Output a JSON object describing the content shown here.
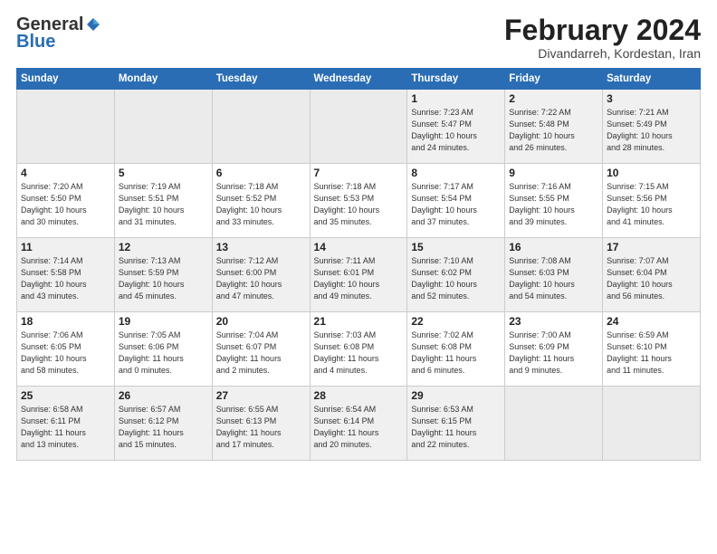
{
  "logo": {
    "line1": "General",
    "line2": "Blue"
  },
  "title": {
    "month": "February 2024",
    "location": "Divandarreh, Kordestan, Iran"
  },
  "weekdays": [
    "Sunday",
    "Monday",
    "Tuesday",
    "Wednesday",
    "Thursday",
    "Friday",
    "Saturday"
  ],
  "weeks": [
    [
      {
        "day": "",
        "detail": ""
      },
      {
        "day": "",
        "detail": ""
      },
      {
        "day": "",
        "detail": ""
      },
      {
        "day": "",
        "detail": ""
      },
      {
        "day": "1",
        "detail": "Sunrise: 7:23 AM\nSunset: 5:47 PM\nDaylight: 10 hours\nand 24 minutes."
      },
      {
        "day": "2",
        "detail": "Sunrise: 7:22 AM\nSunset: 5:48 PM\nDaylight: 10 hours\nand 26 minutes."
      },
      {
        "day": "3",
        "detail": "Sunrise: 7:21 AM\nSunset: 5:49 PM\nDaylight: 10 hours\nand 28 minutes."
      }
    ],
    [
      {
        "day": "4",
        "detail": "Sunrise: 7:20 AM\nSunset: 5:50 PM\nDaylight: 10 hours\nand 30 minutes."
      },
      {
        "day": "5",
        "detail": "Sunrise: 7:19 AM\nSunset: 5:51 PM\nDaylight: 10 hours\nand 31 minutes."
      },
      {
        "day": "6",
        "detail": "Sunrise: 7:18 AM\nSunset: 5:52 PM\nDaylight: 10 hours\nand 33 minutes."
      },
      {
        "day": "7",
        "detail": "Sunrise: 7:18 AM\nSunset: 5:53 PM\nDaylight: 10 hours\nand 35 minutes."
      },
      {
        "day": "8",
        "detail": "Sunrise: 7:17 AM\nSunset: 5:54 PM\nDaylight: 10 hours\nand 37 minutes."
      },
      {
        "day": "9",
        "detail": "Sunrise: 7:16 AM\nSunset: 5:55 PM\nDaylight: 10 hours\nand 39 minutes."
      },
      {
        "day": "10",
        "detail": "Sunrise: 7:15 AM\nSunset: 5:56 PM\nDaylight: 10 hours\nand 41 minutes."
      }
    ],
    [
      {
        "day": "11",
        "detail": "Sunrise: 7:14 AM\nSunset: 5:58 PM\nDaylight: 10 hours\nand 43 minutes."
      },
      {
        "day": "12",
        "detail": "Sunrise: 7:13 AM\nSunset: 5:59 PM\nDaylight: 10 hours\nand 45 minutes."
      },
      {
        "day": "13",
        "detail": "Sunrise: 7:12 AM\nSunset: 6:00 PM\nDaylight: 10 hours\nand 47 minutes."
      },
      {
        "day": "14",
        "detail": "Sunrise: 7:11 AM\nSunset: 6:01 PM\nDaylight: 10 hours\nand 49 minutes."
      },
      {
        "day": "15",
        "detail": "Sunrise: 7:10 AM\nSunset: 6:02 PM\nDaylight: 10 hours\nand 52 minutes."
      },
      {
        "day": "16",
        "detail": "Sunrise: 7:08 AM\nSunset: 6:03 PM\nDaylight: 10 hours\nand 54 minutes."
      },
      {
        "day": "17",
        "detail": "Sunrise: 7:07 AM\nSunset: 6:04 PM\nDaylight: 10 hours\nand 56 minutes."
      }
    ],
    [
      {
        "day": "18",
        "detail": "Sunrise: 7:06 AM\nSunset: 6:05 PM\nDaylight: 10 hours\nand 58 minutes."
      },
      {
        "day": "19",
        "detail": "Sunrise: 7:05 AM\nSunset: 6:06 PM\nDaylight: 11 hours\nand 0 minutes."
      },
      {
        "day": "20",
        "detail": "Sunrise: 7:04 AM\nSunset: 6:07 PM\nDaylight: 11 hours\nand 2 minutes."
      },
      {
        "day": "21",
        "detail": "Sunrise: 7:03 AM\nSunset: 6:08 PM\nDaylight: 11 hours\nand 4 minutes."
      },
      {
        "day": "22",
        "detail": "Sunrise: 7:02 AM\nSunset: 6:08 PM\nDaylight: 11 hours\nand 6 minutes."
      },
      {
        "day": "23",
        "detail": "Sunrise: 7:00 AM\nSunset: 6:09 PM\nDaylight: 11 hours\nand 9 minutes."
      },
      {
        "day": "24",
        "detail": "Sunrise: 6:59 AM\nSunset: 6:10 PM\nDaylight: 11 hours\nand 11 minutes."
      }
    ],
    [
      {
        "day": "25",
        "detail": "Sunrise: 6:58 AM\nSunset: 6:11 PM\nDaylight: 11 hours\nand 13 minutes."
      },
      {
        "day": "26",
        "detail": "Sunrise: 6:57 AM\nSunset: 6:12 PM\nDaylight: 11 hours\nand 15 minutes."
      },
      {
        "day": "27",
        "detail": "Sunrise: 6:55 AM\nSunset: 6:13 PM\nDaylight: 11 hours\nand 17 minutes."
      },
      {
        "day": "28",
        "detail": "Sunrise: 6:54 AM\nSunset: 6:14 PM\nDaylight: 11 hours\nand 20 minutes."
      },
      {
        "day": "29",
        "detail": "Sunrise: 6:53 AM\nSunset: 6:15 PM\nDaylight: 11 hours\nand 22 minutes."
      },
      {
        "day": "",
        "detail": ""
      },
      {
        "day": "",
        "detail": ""
      }
    ]
  ]
}
